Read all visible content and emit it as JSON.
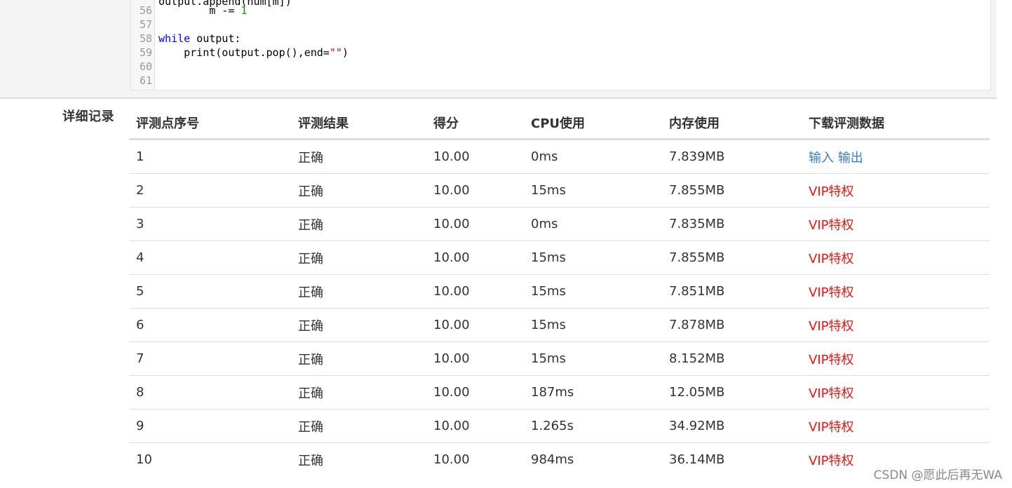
{
  "code": {
    "partial_line": "            output.append(num[m])",
    "lines": [
      {
        "no": "56",
        "indent": "        ",
        "parts": [
          {
            "t": "m -= ",
            "c": ""
          },
          {
            "t": "1",
            "c": "num"
          }
        ]
      },
      {
        "no": "57",
        "indent": "",
        "parts": []
      },
      {
        "no": "58",
        "indent": "",
        "parts": [
          {
            "t": "while",
            "c": "kw"
          },
          {
            "t": " output:",
            "c": ""
          }
        ]
      },
      {
        "no": "59",
        "indent": "    ",
        "parts": [
          {
            "t": "print(output.pop(),end=",
            "c": ""
          },
          {
            "t": "\"\"",
            "c": "str"
          },
          {
            "t": ")",
            "c": ""
          }
        ]
      },
      {
        "no": "60",
        "indent": "",
        "parts": []
      },
      {
        "no": "61",
        "indent": "",
        "parts": []
      }
    ]
  },
  "records": {
    "label": "详细记录",
    "headers": {
      "index": "评测点序号",
      "result": "评测结果",
      "score": "得分",
      "cpu": "CPU使用",
      "memory": "内存使用",
      "download": "下载评测数据"
    },
    "download_input": "输入",
    "download_output": "输出",
    "vip_label": "VIP特权",
    "rows": [
      {
        "index": "1",
        "result": "正确",
        "score": "10.00",
        "cpu": "0ms",
        "memory": "7.839MB",
        "download": "io"
      },
      {
        "index": "2",
        "result": "正确",
        "score": "10.00",
        "cpu": "15ms",
        "memory": "7.855MB",
        "download": "vip"
      },
      {
        "index": "3",
        "result": "正确",
        "score": "10.00",
        "cpu": "0ms",
        "memory": "7.835MB",
        "download": "vip"
      },
      {
        "index": "4",
        "result": "正确",
        "score": "10.00",
        "cpu": "15ms",
        "memory": "7.855MB",
        "download": "vip"
      },
      {
        "index": "5",
        "result": "正确",
        "score": "10.00",
        "cpu": "15ms",
        "memory": "7.851MB",
        "download": "vip"
      },
      {
        "index": "6",
        "result": "正确",
        "score": "10.00",
        "cpu": "15ms",
        "memory": "7.878MB",
        "download": "vip"
      },
      {
        "index": "7",
        "result": "正确",
        "score": "10.00",
        "cpu": "15ms",
        "memory": "8.152MB",
        "download": "vip"
      },
      {
        "index": "8",
        "result": "正确",
        "score": "10.00",
        "cpu": "187ms",
        "memory": "12.05MB",
        "download": "vip"
      },
      {
        "index": "9",
        "result": "正确",
        "score": "10.00",
        "cpu": "1.265s",
        "memory": "34.92MB",
        "download": "vip"
      },
      {
        "index": "10",
        "result": "正确",
        "score": "10.00",
        "cpu": "984ms",
        "memory": "36.14MB",
        "download": "vip"
      }
    ]
  },
  "watermark": "CSDN @愿此后再无WA",
  "colors": {
    "link_blue": "#3b7ec7",
    "vip_red": "#e01717",
    "keyword_blue": "#0000ff",
    "number_green": "#1a8a1a"
  }
}
